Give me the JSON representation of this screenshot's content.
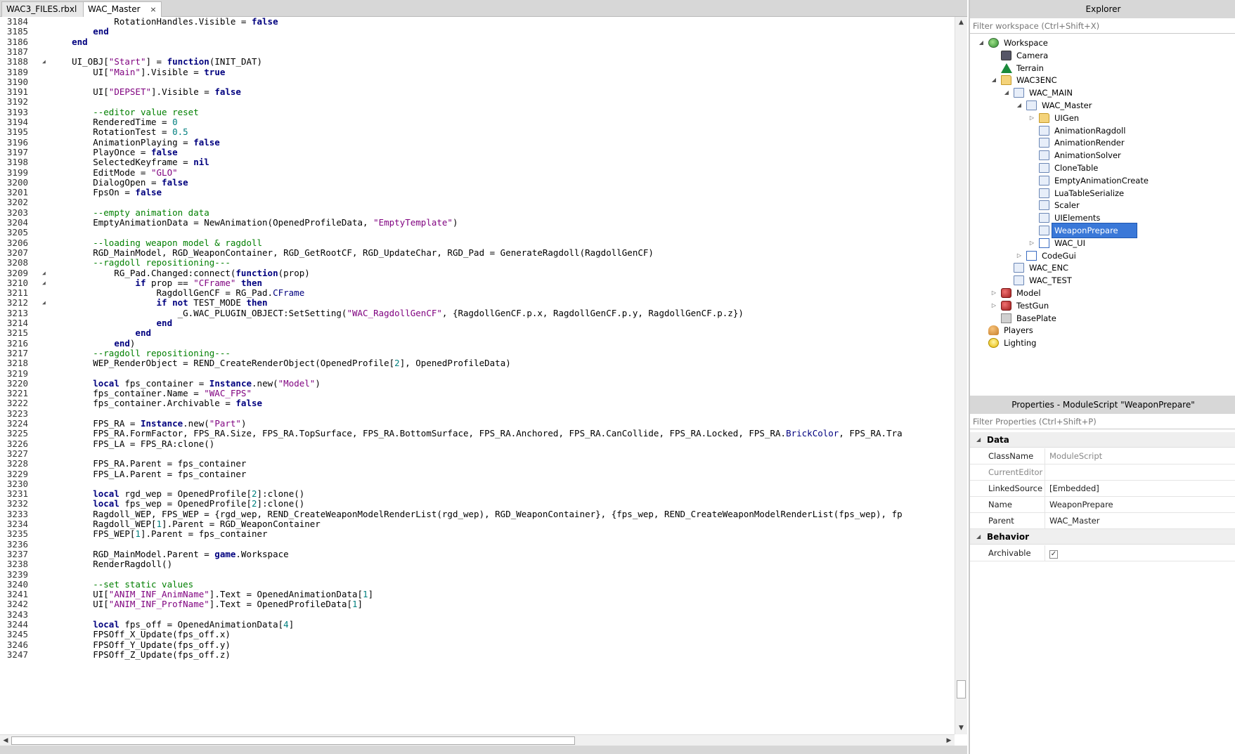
{
  "tabs": [
    {
      "label": "WAC3_FILES.rbxl",
      "close": "×"
    },
    {
      "label": "WAC_Master",
      "close": "×"
    }
  ],
  "code_lines": [
    {
      "n": "3184",
      "html": "            RotationHandles.Visible = <span class=\"kw\">false</span>"
    },
    {
      "n": "3185",
      "html": "        <span class=\"kw\">end</span>"
    },
    {
      "n": "3186",
      "html": "    <span class=\"kw\">end</span>"
    },
    {
      "n": "3187",
      "html": ""
    },
    {
      "n": "3188",
      "fold": true,
      "html": "    UI_OBJ[<span class=\"str\">\"Start\"</span>] = <span class=\"kw\">function</span>(INIT_DAT)"
    },
    {
      "n": "3189",
      "html": "        UI[<span class=\"str\">\"Main\"</span>].Visible = <span class=\"kw\">true</span>"
    },
    {
      "n": "3190",
      "html": ""
    },
    {
      "n": "3191",
      "html": "        UI[<span class=\"str\">\"DEPSET\"</span>].Visible = <span class=\"kw\">false</span>"
    },
    {
      "n": "3192",
      "html": ""
    },
    {
      "n": "3193",
      "html": "        <span class=\"cmt\">--editor value reset</span>"
    },
    {
      "n": "3194",
      "html": "        RenderedTime = <span class=\"num\">0</span>"
    },
    {
      "n": "3195",
      "html": "        RotationTest = <span class=\"num\">0.5</span>"
    },
    {
      "n": "3196",
      "html": "        AnimationPlaying = <span class=\"kw\">false</span>"
    },
    {
      "n": "3197",
      "html": "        PlayOnce = <span class=\"kw\">false</span>"
    },
    {
      "n": "3198",
      "html": "        SelectedKeyframe = <span class=\"kw\">nil</span>"
    },
    {
      "n": "3199",
      "html": "        EditMode = <span class=\"str\">\"GLO\"</span>"
    },
    {
      "n": "3200",
      "html": "        DialogOpen = <span class=\"kw\">false</span>"
    },
    {
      "n": "3201",
      "html": "        FpsOn = <span class=\"kw\">false</span>"
    },
    {
      "n": "3202",
      "html": ""
    },
    {
      "n": "3203",
      "html": "        <span class=\"cmt\">--empty animation data</span>"
    },
    {
      "n": "3204",
      "html": "        EmptyAnimationData = NewAnimation(OpenedProfileData, <span class=\"str\">\"EmptyTemplate\"</span>)"
    },
    {
      "n": "3205",
      "html": ""
    },
    {
      "n": "3206",
      "html": "        <span class=\"cmt\">--loading weapon model &amp; ragdoll</span>"
    },
    {
      "n": "3207",
      "html": "        RGD_MainModel, RGD_WeaponContainer, RGD_GetRootCF, RGD_UpdateChar, RGD_Pad = GenerateRagdoll(RagdollGenCF)"
    },
    {
      "n": "3208",
      "html": "        <span class=\"cmt\">--ragdoll repositioning---</span>"
    },
    {
      "n": "3209",
      "fold": true,
      "html": "            RG_Pad.Changed:connect(<span class=\"kw\">function</span>(prop)"
    },
    {
      "n": "3210",
      "fold": true,
      "html": "                <span class=\"kw\">if</span> prop == <span class=\"str\">\"CFrame\"</span> <span class=\"kw\">then</span>"
    },
    {
      "n": "3211",
      "html": "                    RagdollGenCF = RG_Pad.<span class=\"kw\" style=\"font-weight:normal;color:#00007f\">CFrame</span>"
    },
    {
      "n": "3212",
      "fold": true,
      "html": "                    <span class=\"kw\">if not</span> TEST_MODE <span class=\"kw\">then</span>"
    },
    {
      "n": "3213",
      "html": "                        _G.WAC_PLUGIN_OBJECT:SetSetting(<span class=\"str\">\"WAC_RagdollGenCF\"</span>, {RagdollGenCF.p.x, RagdollGenCF.p.y, RagdollGenCF.p.z})"
    },
    {
      "n": "3214",
      "html": "                    <span class=\"kw\">end</span>"
    },
    {
      "n": "3215",
      "html": "                <span class=\"kw\">end</span>"
    },
    {
      "n": "3216",
      "html": "            <span class=\"kw\">end</span>)"
    },
    {
      "n": "3217",
      "html": "        <span class=\"cmt\">--ragdoll repositioning---</span>"
    },
    {
      "n": "3218",
      "html": "        WEP_RenderObject = REND_CreateRenderObject(OpenedProfile[<span class=\"num\">2</span>], OpenedProfileData)"
    },
    {
      "n": "3219",
      "html": ""
    },
    {
      "n": "3220",
      "html": "        <span class=\"kw\">local</span> fps_container = <span class=\"kw\">Instance</span>.new(<span class=\"str\">\"Model\"</span>)"
    },
    {
      "n": "3221",
      "html": "        fps_container.Name = <span class=\"str\">\"WAC_FPS\"</span>"
    },
    {
      "n": "3222",
      "html": "        fps_container.Archivable = <span class=\"kw\">false</span>"
    },
    {
      "n": "3223",
      "html": ""
    },
    {
      "n": "3224",
      "html": "        FPS_RA = <span class=\"kw\">Instance</span>.new(<span class=\"str\">\"Part\"</span>)"
    },
    {
      "n": "3225",
      "html": "        FPS_RA.FormFactor, FPS_RA.Size, FPS_RA.TopSurface, FPS_RA.BottomSurface, FPS_RA.Anchored, FPS_RA.CanCollide, FPS_RA.Locked, FPS_RA.<span style=\"color:#00007f\">BrickColor</span>, FPS_RA.Tra"
    },
    {
      "n": "3226",
      "html": "        FPS_LA = FPS_RA:clone()"
    },
    {
      "n": "3227",
      "html": ""
    },
    {
      "n": "3228",
      "html": "        FPS_RA.Parent = fps_container"
    },
    {
      "n": "3229",
      "html": "        FPS_LA.Parent = fps_container"
    },
    {
      "n": "3230",
      "html": ""
    },
    {
      "n": "3231",
      "html": "        <span class=\"kw\">local</span> rgd_wep = OpenedProfile[<span class=\"num\">2</span>]:clone()"
    },
    {
      "n": "3232",
      "html": "        <span class=\"kw\">local</span> fps_wep = OpenedProfile[<span class=\"num\">2</span>]:clone()"
    },
    {
      "n": "3233",
      "html": "        Ragdoll_WEP, FPS_WEP = {rgd_wep, REND_CreateWeaponModelRenderList(rgd_wep), RGD_WeaponContainer}, {fps_wep, REND_CreateWeaponModelRenderList(fps_wep), fp"
    },
    {
      "n": "3234",
      "html": "        Ragdoll_WEP[<span class=\"num\">1</span>].Parent = RGD_WeaponContainer"
    },
    {
      "n": "3235",
      "html": "        FPS_WEP[<span class=\"num\">1</span>].Parent = fps_container"
    },
    {
      "n": "3236",
      "html": ""
    },
    {
      "n": "3237",
      "html": "        RGD_MainModel.Parent = <span class=\"kw\">game</span>.Workspace"
    },
    {
      "n": "3238",
      "html": "        RenderRagdoll()"
    },
    {
      "n": "3239",
      "html": ""
    },
    {
      "n": "3240",
      "html": "        <span class=\"cmt\">--set static values</span>"
    },
    {
      "n": "3241",
      "html": "        UI[<span class=\"str\">\"ANIM_INF_AnimName\"</span>].Text = OpenedAnimationData[<span class=\"num\">1</span>]"
    },
    {
      "n": "3242",
      "html": "        UI[<span class=\"str\">\"ANIM_INF_ProfName\"</span>].Text = OpenedProfileData[<span class=\"num\">1</span>]"
    },
    {
      "n": "3243",
      "html": ""
    },
    {
      "n": "3244",
      "html": "        <span class=\"kw\">local</span> fps_off = OpenedAnimationData[<span class=\"num\">4</span>]"
    },
    {
      "n": "3245",
      "html": "        FPSOff_X_Update(fps_off.x)"
    },
    {
      "n": "3246",
      "html": "        FPSOff_Y_Update(fps_off.y)"
    },
    {
      "n": "3247",
      "html": "        FPSOff_Z_Update(fps_off.z)"
    }
  ],
  "explorer": {
    "title": "Explorer",
    "filter_placeholder": "Filter workspace (Ctrl+Shift+X)",
    "items": [
      {
        "label": "Workspace",
        "depth": 0,
        "expander": "◢",
        "icon": "globe"
      },
      {
        "label": "Camera",
        "depth": 1,
        "expander": "",
        "icon": "camera"
      },
      {
        "label": "Terrain",
        "depth": 1,
        "expander": "",
        "icon": "terrain"
      },
      {
        "label": "WAC3ENC",
        "depth": 1,
        "expander": "◢",
        "icon": "folder"
      },
      {
        "label": "WAC_MAIN",
        "depth": 2,
        "expander": "◢",
        "icon": "script"
      },
      {
        "label": "WAC_Master",
        "depth": 3,
        "expander": "◢",
        "icon": "script"
      },
      {
        "label": "UIGen",
        "depth": 4,
        "expander": "▷",
        "icon": "folder"
      },
      {
        "label": "AnimationRagdoll",
        "depth": 4,
        "expander": "",
        "icon": "script"
      },
      {
        "label": "AnimationRender",
        "depth": 4,
        "expander": "",
        "icon": "script"
      },
      {
        "label": "AnimationSolver",
        "depth": 4,
        "expander": "",
        "icon": "script"
      },
      {
        "label": "CloneTable",
        "depth": 4,
        "expander": "",
        "icon": "script"
      },
      {
        "label": "EmptyAnimationCreate",
        "depth": 4,
        "expander": "",
        "icon": "script"
      },
      {
        "label": "LuaTableSerialize",
        "depth": 4,
        "expander": "",
        "icon": "script"
      },
      {
        "label": "Scaler",
        "depth": 4,
        "expander": "",
        "icon": "script"
      },
      {
        "label": "UIElements",
        "depth": 4,
        "expander": "",
        "icon": "script"
      },
      {
        "label": "WeaponPrepare",
        "depth": 4,
        "expander": "",
        "icon": "script",
        "selected": true
      },
      {
        "label": "WAC_UI",
        "depth": 4,
        "expander": "▷",
        "icon": "gui"
      },
      {
        "label": "CodeGui",
        "depth": 3,
        "expander": "▷",
        "icon": "gui"
      },
      {
        "label": "WAC_ENC",
        "depth": 2,
        "expander": "",
        "icon": "script"
      },
      {
        "label": "WAC_TEST",
        "depth": 2,
        "expander": "",
        "icon": "script"
      },
      {
        "label": "Model",
        "depth": 1,
        "expander": "▷",
        "icon": "model"
      },
      {
        "label": "TestGun",
        "depth": 1,
        "expander": "▷",
        "icon": "model"
      },
      {
        "label": "BasePlate",
        "depth": 1,
        "expander": "",
        "icon": "part"
      },
      {
        "label": "Players",
        "depth": 0,
        "expander": "",
        "icon": "players"
      },
      {
        "label": "Lighting",
        "depth": 0,
        "expander": "",
        "icon": "light"
      }
    ]
  },
  "properties": {
    "title": "Properties - ModuleScript \"WeaponPrepare\"",
    "filter_placeholder": "Filter Properties (Ctrl+Shift+P)",
    "categories": [
      {
        "name": "Data",
        "rows": [
          {
            "name": "ClassName",
            "value": "ModuleScript",
            "dim_name": false,
            "dim_value": true
          },
          {
            "name": "CurrentEditor",
            "value": "",
            "dim_name": true,
            "dim_value": false
          },
          {
            "name": "LinkedSource",
            "value": "[Embedded]",
            "dim_name": false,
            "dim_value": false
          },
          {
            "name": "Name",
            "value": "WeaponPrepare",
            "dim_name": false,
            "dim_value": false
          },
          {
            "name": "Parent",
            "value": "WAC_Master",
            "dim_name": false,
            "dim_value": false
          }
        ]
      },
      {
        "name": "Behavior",
        "rows": [
          {
            "name": "Archivable",
            "value": "✓",
            "checkbox": true,
            "dim_name": false,
            "dim_value": false
          }
        ]
      }
    ]
  },
  "scroll": {
    "up": "▲",
    "down": "▼",
    "left": "◀",
    "right": "▶"
  },
  "icons": {
    "expanded": "triangle-expanded-icon",
    "collapsed": "triangle-collapsed-icon",
    "fold": "fold-marker-icon"
  }
}
